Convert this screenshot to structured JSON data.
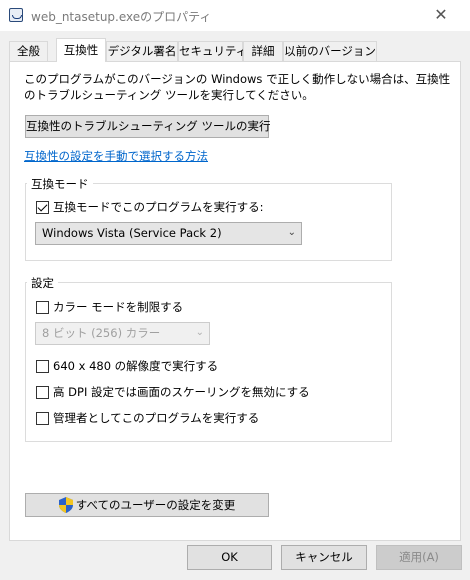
{
  "window": {
    "title": "web_ntasetup.exeのプロパティ",
    "close_glyph": "✕"
  },
  "tabs": [
    {
      "label": "全般"
    },
    {
      "label": "互換性"
    },
    {
      "label": "デジタル署名"
    },
    {
      "label": "セキュリティ"
    },
    {
      "label": "詳細"
    },
    {
      "label": "以前のバージョン"
    }
  ],
  "compat": {
    "description": "このプログラムがこのバージョンの Windows で正しく動作しない場合は、互換性のトラブルシューティング ツールを実行してください。",
    "troubleshoot_button": "互換性のトラブルシューティング ツールの実行",
    "manual_link": "互換性の設定を手動で選択する方法",
    "mode_group": {
      "title": "互換モード",
      "checkbox_label": "互換モードでこのプログラムを実行する:",
      "checked": true,
      "selected_os": "Windows Vista (Service Pack 2)"
    },
    "settings_group": {
      "title": "設定",
      "color_mode_label": "カラー モードを制限する",
      "color_select": "8 ビット (256) カラー",
      "resolution_label": "640 x 480 の解像度で実行する",
      "dpi_label": "高 DPI 設定では画面のスケーリングを無効にする",
      "admin_label": "管理者としてこのプログラムを実行する"
    },
    "all_users_button": "すべてのユーザーの設定を変更"
  },
  "footer": {
    "ok": "OK",
    "cancel": "キャンセル",
    "apply": "適用(A)"
  },
  "icons": {
    "dropdown": "chevron-down",
    "shield": "uac-shield"
  }
}
